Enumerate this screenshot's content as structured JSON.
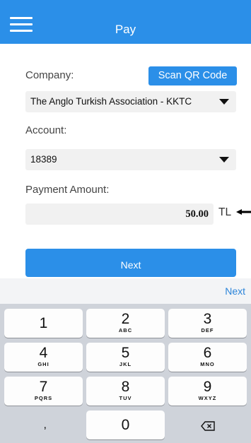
{
  "header": {
    "title": "Pay",
    "menu_icon": "hamburger-menu-icon"
  },
  "form": {
    "company_label": "Company:",
    "scan_label": "Scan QR Code",
    "company_value": "The Anglo Turkish Association - KKTC",
    "account_label": "Account:",
    "account_value": "18389",
    "amount_label": "Payment Amount:",
    "amount_value": "50.00",
    "currency": "TL",
    "next_label": "Next"
  },
  "keyboard": {
    "toolbar_next": "Next",
    "keys": [
      {
        "num": "1",
        "letters": ""
      },
      {
        "num": "2",
        "letters": "ABC"
      },
      {
        "num": "3",
        "letters": "DEF"
      },
      {
        "num": "4",
        "letters": "GHI"
      },
      {
        "num": "5",
        "letters": "JKL"
      },
      {
        "num": "6",
        "letters": "MNO"
      },
      {
        "num": "7",
        "letters": "PQRS"
      },
      {
        "num": "8",
        "letters": "TUV"
      },
      {
        "num": "9",
        "letters": "WXYZ"
      },
      {
        "num": ",",
        "letters": ""
      },
      {
        "num": "0",
        "letters": ""
      },
      {
        "num": "",
        "letters": "",
        "icon": "backspace-icon"
      }
    ]
  },
  "colors": {
    "accent": "#2b8fe8",
    "keyboard_bg": "#cfd3da",
    "arrow_purple": "#9b2fd0"
  }
}
